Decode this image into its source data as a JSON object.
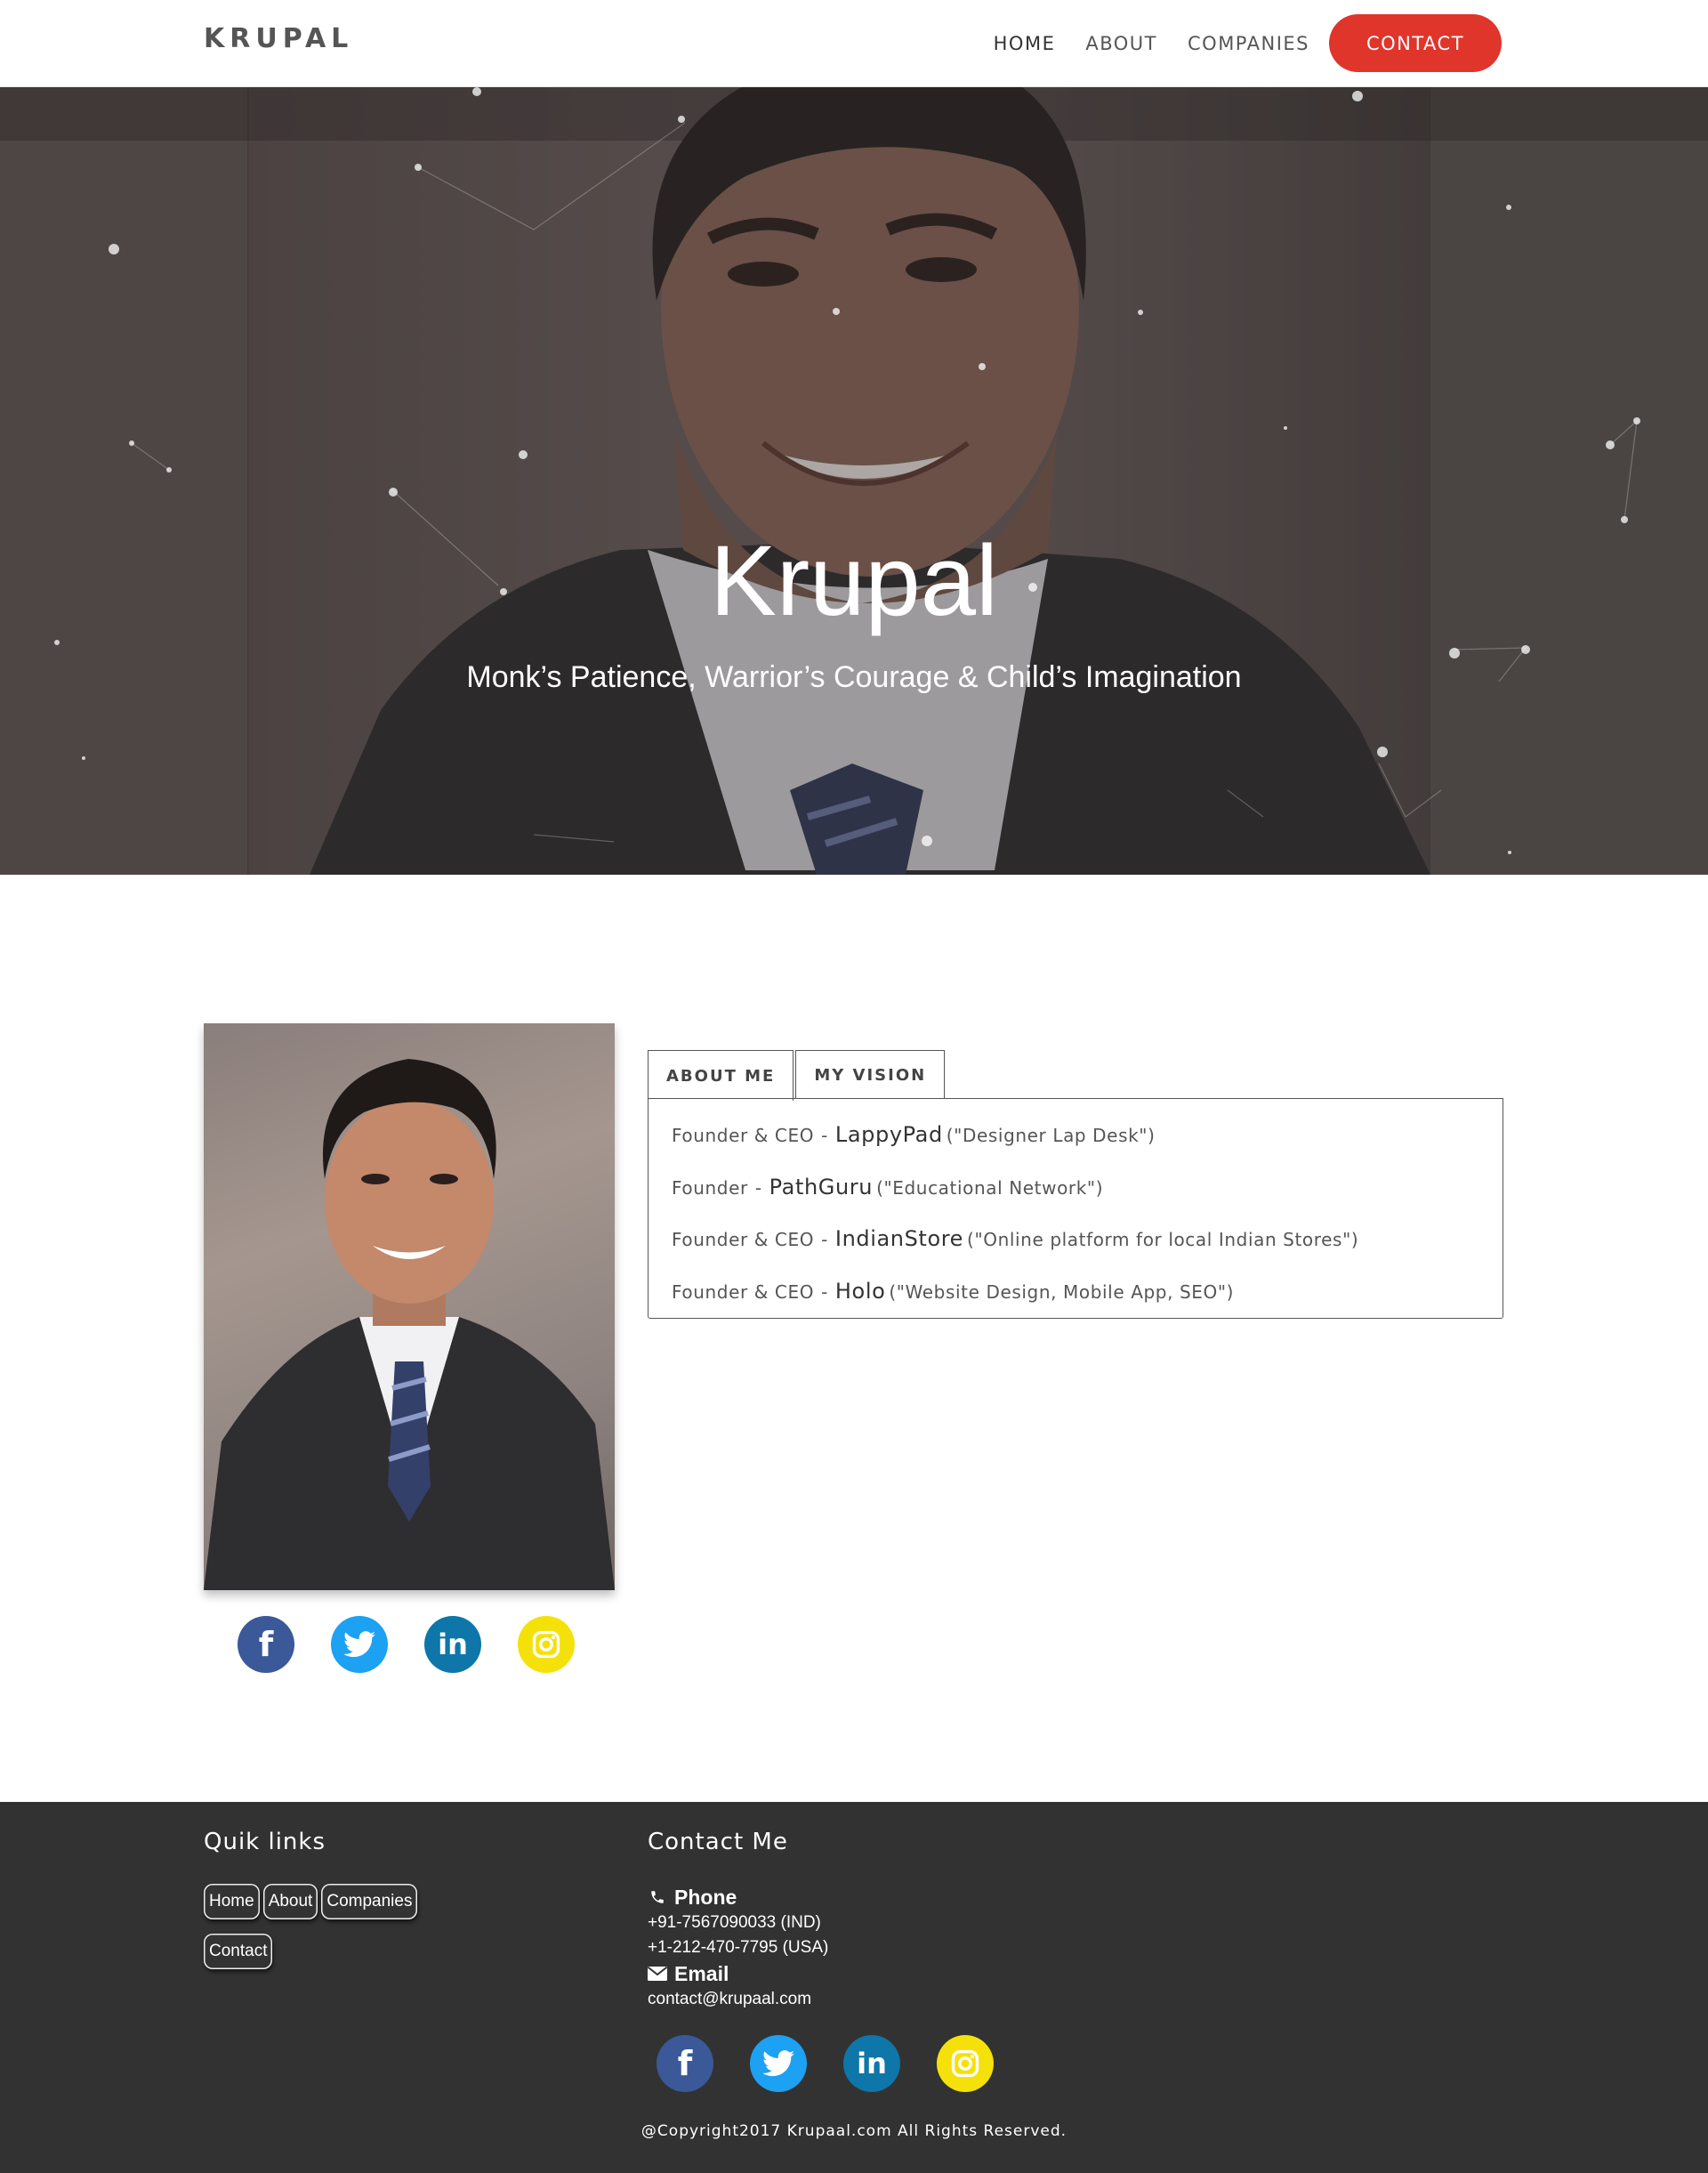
{
  "nav": {
    "brand": "KRUPAL",
    "links": [
      "HOME",
      "ABOUT",
      "COMPANIES"
    ],
    "cta": "CONTACT"
  },
  "hero": {
    "title": "Krupal",
    "subtitle": "Monk’s Patience, Warrior’s Courage & Child’s Imagination"
  },
  "tabs": [
    "ABOUT ME",
    "MY VISION"
  ],
  "roles": [
    {
      "role": "Founder & CEO",
      "company": "LappyPad",
      "desc": "(\"Designer Lap Desk\")"
    },
    {
      "role": "Founder",
      "company": "PathGuru",
      "desc": "(\"Educational Network\")"
    },
    {
      "role": "Founder & CEO",
      "company": "IndianStore",
      "desc": "(\"Online platform for local Indian Stores\")"
    },
    {
      "role": "Founder & CEO",
      "company": "Holo",
      "desc": "(\"Website Design, Mobile App, SEO\")"
    }
  ],
  "social": [
    {
      "name": "facebook",
      "glyph": "f",
      "icon": "facebook-icon"
    },
    {
      "name": "twitter",
      "glyph": "",
      "icon": "twitter-icon"
    },
    {
      "name": "linkedin",
      "glyph": "in",
      "icon": "linkedin-icon"
    },
    {
      "name": "instagram",
      "glyph": "",
      "icon": "instagram-icon"
    }
  ],
  "footer": {
    "quick_title": "Quik links",
    "quick_links": [
      "Home",
      "About",
      "Companies",
      "Contact"
    ],
    "contact_title": "Contact Me",
    "phone_label": "Phone",
    "phones": [
      "+91-7567090033 (IND)",
      "+1-212-470-7795 (USA)"
    ],
    "email_label": "Email",
    "email": "contact@krupaal.com",
    "copyright": "@Copyright2017 Krupaal.com All Rights Reserved."
  },
  "colors": {
    "accent": "#e0352b",
    "facebook": "#3b5998",
    "twitter": "#1da1f2",
    "linkedin": "#0e76a8",
    "instagram": "#f5e10a",
    "footer_bg": "#323232"
  }
}
